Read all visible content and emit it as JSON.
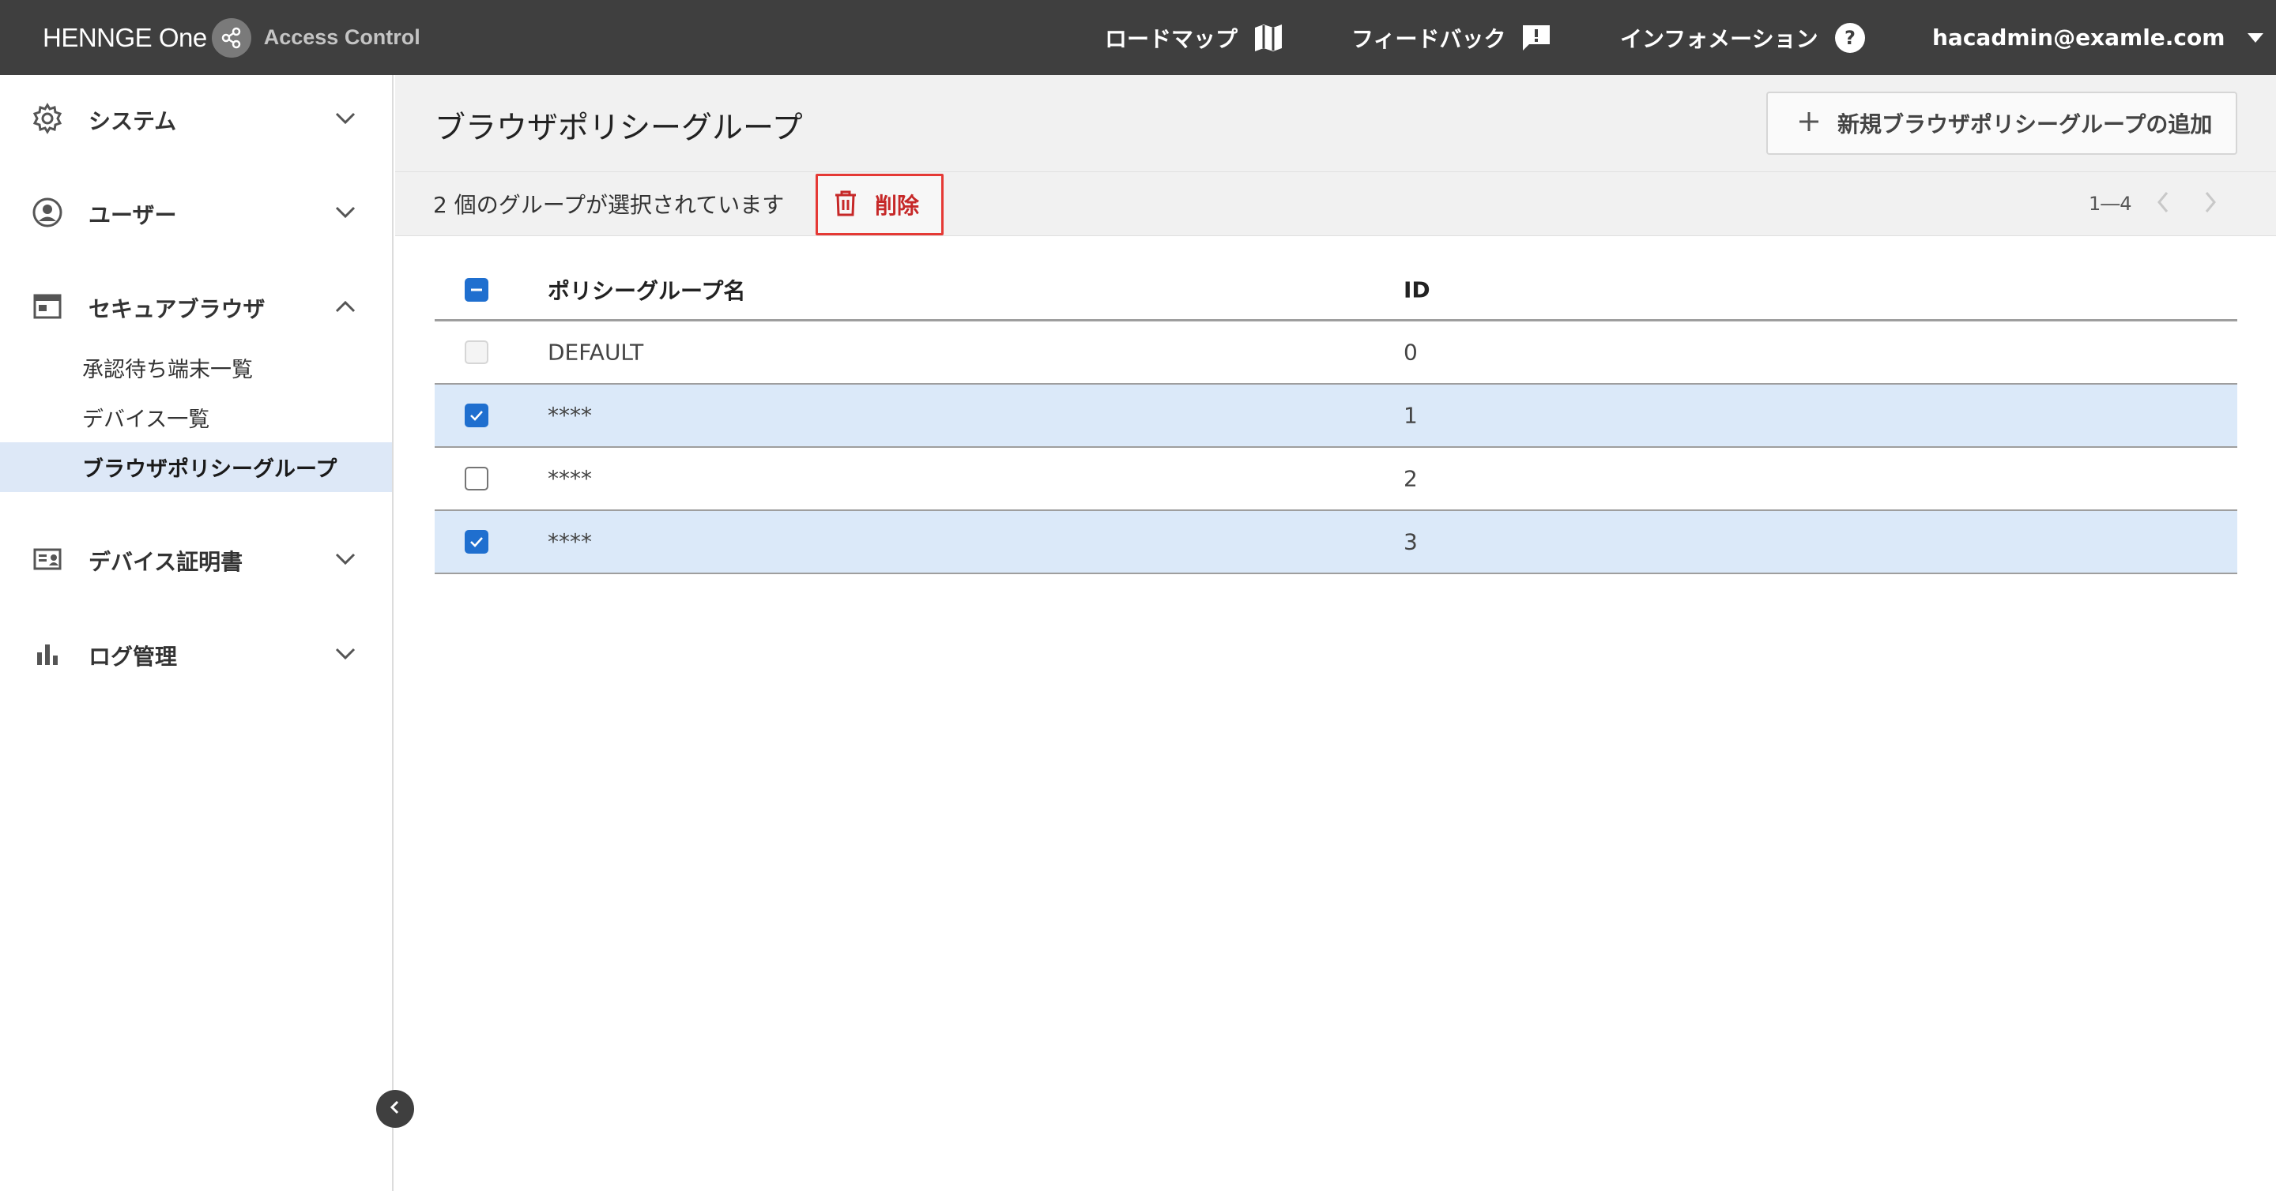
{
  "app": {
    "brand": "HENNGE One",
    "product": "Access Control"
  },
  "topnav": {
    "roadmap": "ロードマップ",
    "feedback": "フィードバック",
    "information": "インフォメーション",
    "user_email": "hacadmin@examle.com"
  },
  "sidebar": {
    "groups": [
      {
        "label": "システム",
        "icon": "gear-icon",
        "expanded": false
      },
      {
        "label": "ユーザー",
        "icon": "user-circle-icon",
        "expanded": false
      },
      {
        "label": "セキュアブラウザ",
        "icon": "browser-window-icon",
        "expanded": true
      },
      {
        "label": "デバイス証明書",
        "icon": "id-card-icon",
        "expanded": false
      },
      {
        "label": "ログ管理",
        "icon": "bar-chart-icon",
        "expanded": false
      }
    ],
    "sub_items": [
      {
        "label": "承認待ち端末一覧",
        "active": false
      },
      {
        "label": "デバイス一覧",
        "active": false
      },
      {
        "label": "ブラウザポリシーグループ",
        "active": true
      }
    ]
  },
  "page": {
    "title": "ブラウザポリシーグループ",
    "add_button": "新規ブラウザポリシーグループの追加"
  },
  "selection_bar": {
    "text": "2 個のグループが選択されています",
    "delete_label": "削除",
    "pager": "1―4"
  },
  "table": {
    "columns": [
      "ポリシーグループ名",
      "ID"
    ],
    "rows": [
      {
        "name": "DEFAULT",
        "id": "0",
        "state": "disabled"
      },
      {
        "name": "****",
        "id": "1",
        "state": "checked"
      },
      {
        "name": "****",
        "id": "2",
        "state": "unchecked"
      },
      {
        "name": "****",
        "id": "3",
        "state": "checked"
      }
    ]
  },
  "colors": {
    "topbar": "#3f3f3f",
    "accent": "#1f6fcf",
    "selected_row": "#dbe9f9",
    "danger": "#e53935"
  }
}
